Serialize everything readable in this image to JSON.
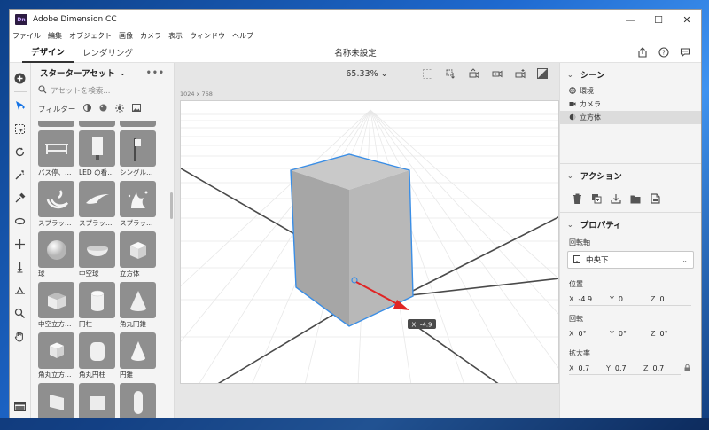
{
  "window": {
    "app_title": "Adobe Dimension CC",
    "logo_text": "Dn",
    "controls": [
      "—",
      "☐",
      "✕"
    ]
  },
  "menu": [
    "ファイル",
    "編集",
    "オブジェクト",
    "画像",
    "カメラ",
    "表示",
    "ウィンドウ",
    "ヘルプ"
  ],
  "tabs": {
    "design": "デザイン",
    "render": "レンダリング"
  },
  "document_title": "名称未設定",
  "assets": {
    "title": "スターターアセット",
    "more": "•••",
    "search_placeholder": "アセットを検索...",
    "filter_label": "フィルター",
    "rows": [
      [
        {
          "label": "バス停、…",
          "icon": "bus-stop"
        },
        {
          "label": "LED の看…",
          "icon": "led-sign"
        },
        {
          "label": "シングル…",
          "icon": "single-sign"
        }
      ],
      [
        {
          "label": "スプラッ…",
          "icon": "splash"
        },
        {
          "label": "スプラッ…",
          "icon": "splash"
        },
        {
          "label": "スプラッ…",
          "icon": "splash"
        }
      ],
      [
        {
          "label": "球",
          "icon": "sphere"
        },
        {
          "label": "中空球",
          "icon": "hollow-sphere"
        },
        {
          "label": "立方体",
          "icon": "cube"
        }
      ],
      [
        {
          "label": "中空立方…",
          "icon": "hollow-cube"
        },
        {
          "label": "円柱",
          "icon": "cylinder"
        },
        {
          "label": "角丸円錐",
          "icon": "rounded-cone"
        }
      ],
      [
        {
          "label": "角丸立方…",
          "icon": "rounded-cube"
        },
        {
          "label": "角丸円柱",
          "icon": "rounded-cylinder"
        },
        {
          "label": "円錐",
          "icon": "cone"
        }
      ]
    ]
  },
  "viewport": {
    "zoom": "65.33%",
    "canvas_size": "1024 x 768",
    "axis_readout": "X: -4.9"
  },
  "scene": {
    "title": "シーン",
    "items": [
      {
        "label": "環境",
        "icon": "environment-icon",
        "selected": false
      },
      {
        "label": "カメラ",
        "icon": "camera-icon",
        "selected": false
      },
      {
        "label": "立方体",
        "icon": "cube-icon",
        "selected": true
      }
    ]
  },
  "actions": {
    "title": "アクション"
  },
  "properties": {
    "title": "プロパティ",
    "pivot_label": "回転軸",
    "pivot_value": "中央下",
    "position_label": "位置",
    "position": {
      "x": "-4.9",
      "y": "0",
      "z": "0"
    },
    "rotation_label": "回転",
    "rotation": {
      "x": "0°",
      "y": "0°",
      "z": "0°"
    },
    "scale_label": "拡大率",
    "scale": {
      "x": "0.7",
      "y": "0.7",
      "z": "0.7"
    }
  },
  "colors": {
    "accent": "#1473e6",
    "arrow": "#e02424",
    "cube_face": "#a9a9a9"
  }
}
